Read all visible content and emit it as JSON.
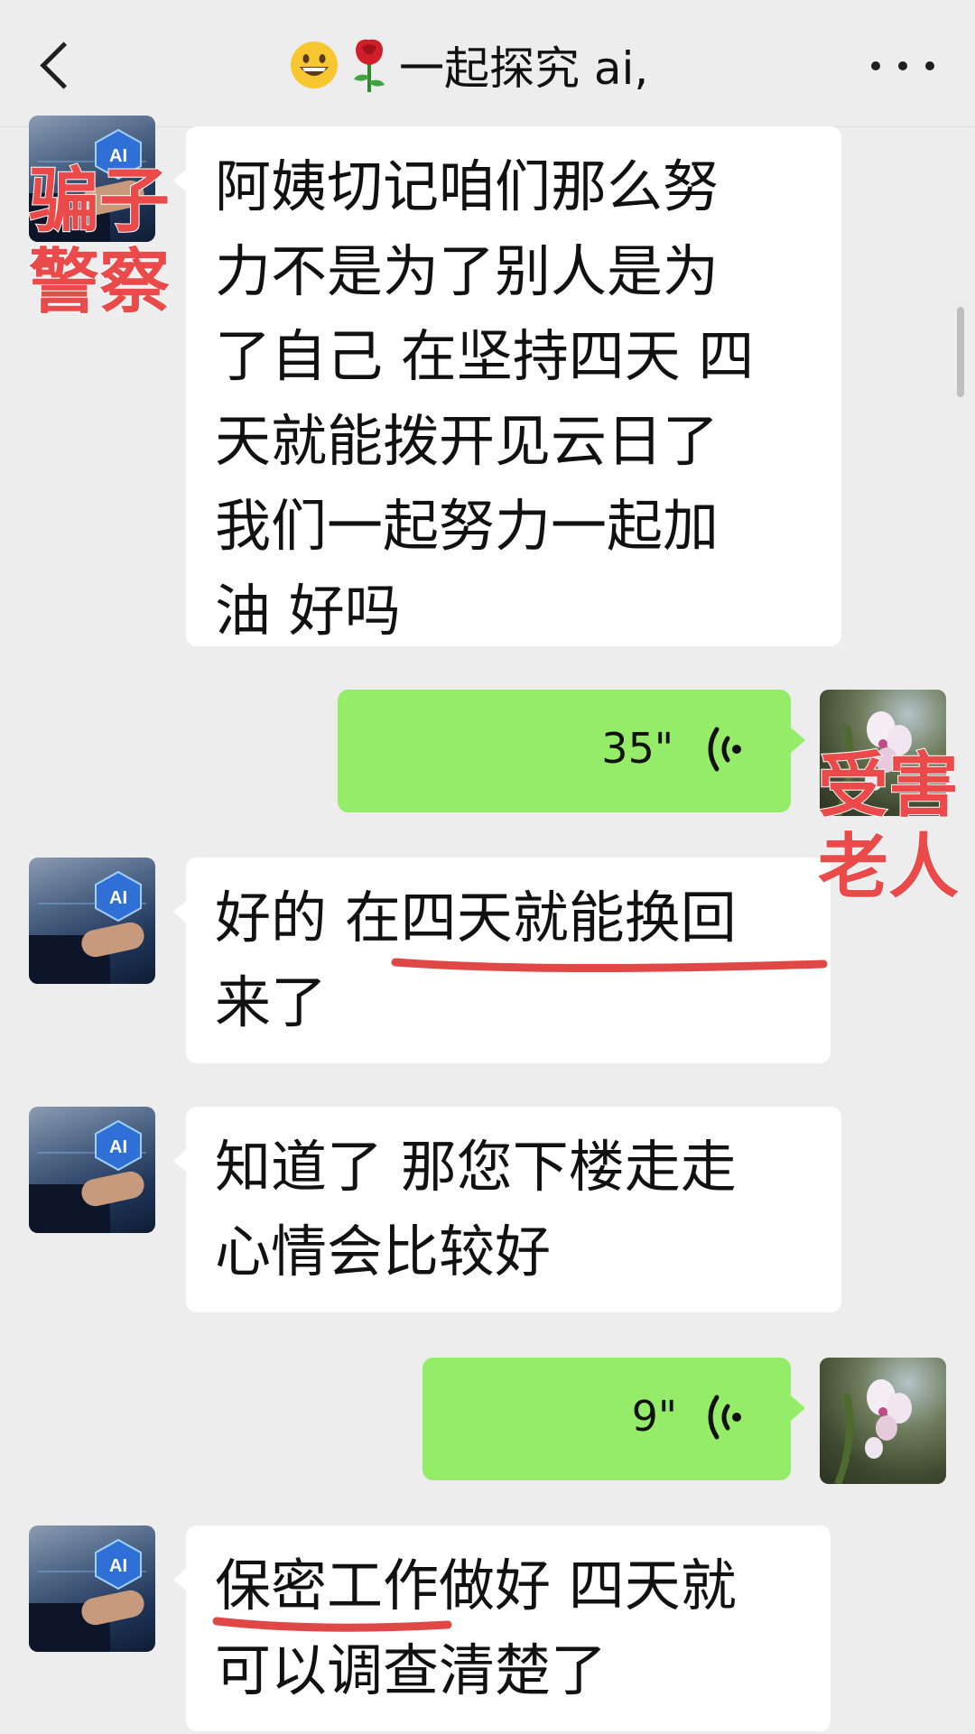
{
  "header": {
    "title": "一起探究 ai,",
    "emoji_icons": [
      "grinning-face-icon",
      "rose-icon"
    ]
  },
  "messages": [
    {
      "side": "left",
      "avatar": "ai-avatar",
      "lines": [
        "阿姨切记咱们那么努",
        "力不是为了别人是为",
        "了自己 在坚持四天 四",
        "天就能拨开见云日了",
        "我们一起努力一起加",
        "油 好吗"
      ]
    },
    {
      "side": "right",
      "type": "voice",
      "duration": "35\""
    },
    {
      "side": "left",
      "avatar": "ai-avatar",
      "lines": [
        "好的 在四天就能换回",
        "来了"
      ]
    },
    {
      "side": "left",
      "avatar": "ai-avatar",
      "lines": [
        "知道了 那您下楼走走",
        "心情会比较好"
      ]
    },
    {
      "side": "right",
      "type": "voice",
      "duration": "9\""
    },
    {
      "side": "left",
      "avatar": "ai-avatar",
      "lines": [
        "保密工作做好 四天就",
        "可以调查清楚了"
      ]
    }
  ],
  "annotations": {
    "scammer": [
      "骗子",
      "警察"
    ],
    "victim": [
      "受害",
      "老人"
    ]
  },
  "avatar_labels": {
    "ai": "AI"
  },
  "colors": {
    "background": "#ededed",
    "bubble_left": "#ffffff",
    "bubble_right": "#95ec69",
    "annotation": "#ea4a4a"
  }
}
